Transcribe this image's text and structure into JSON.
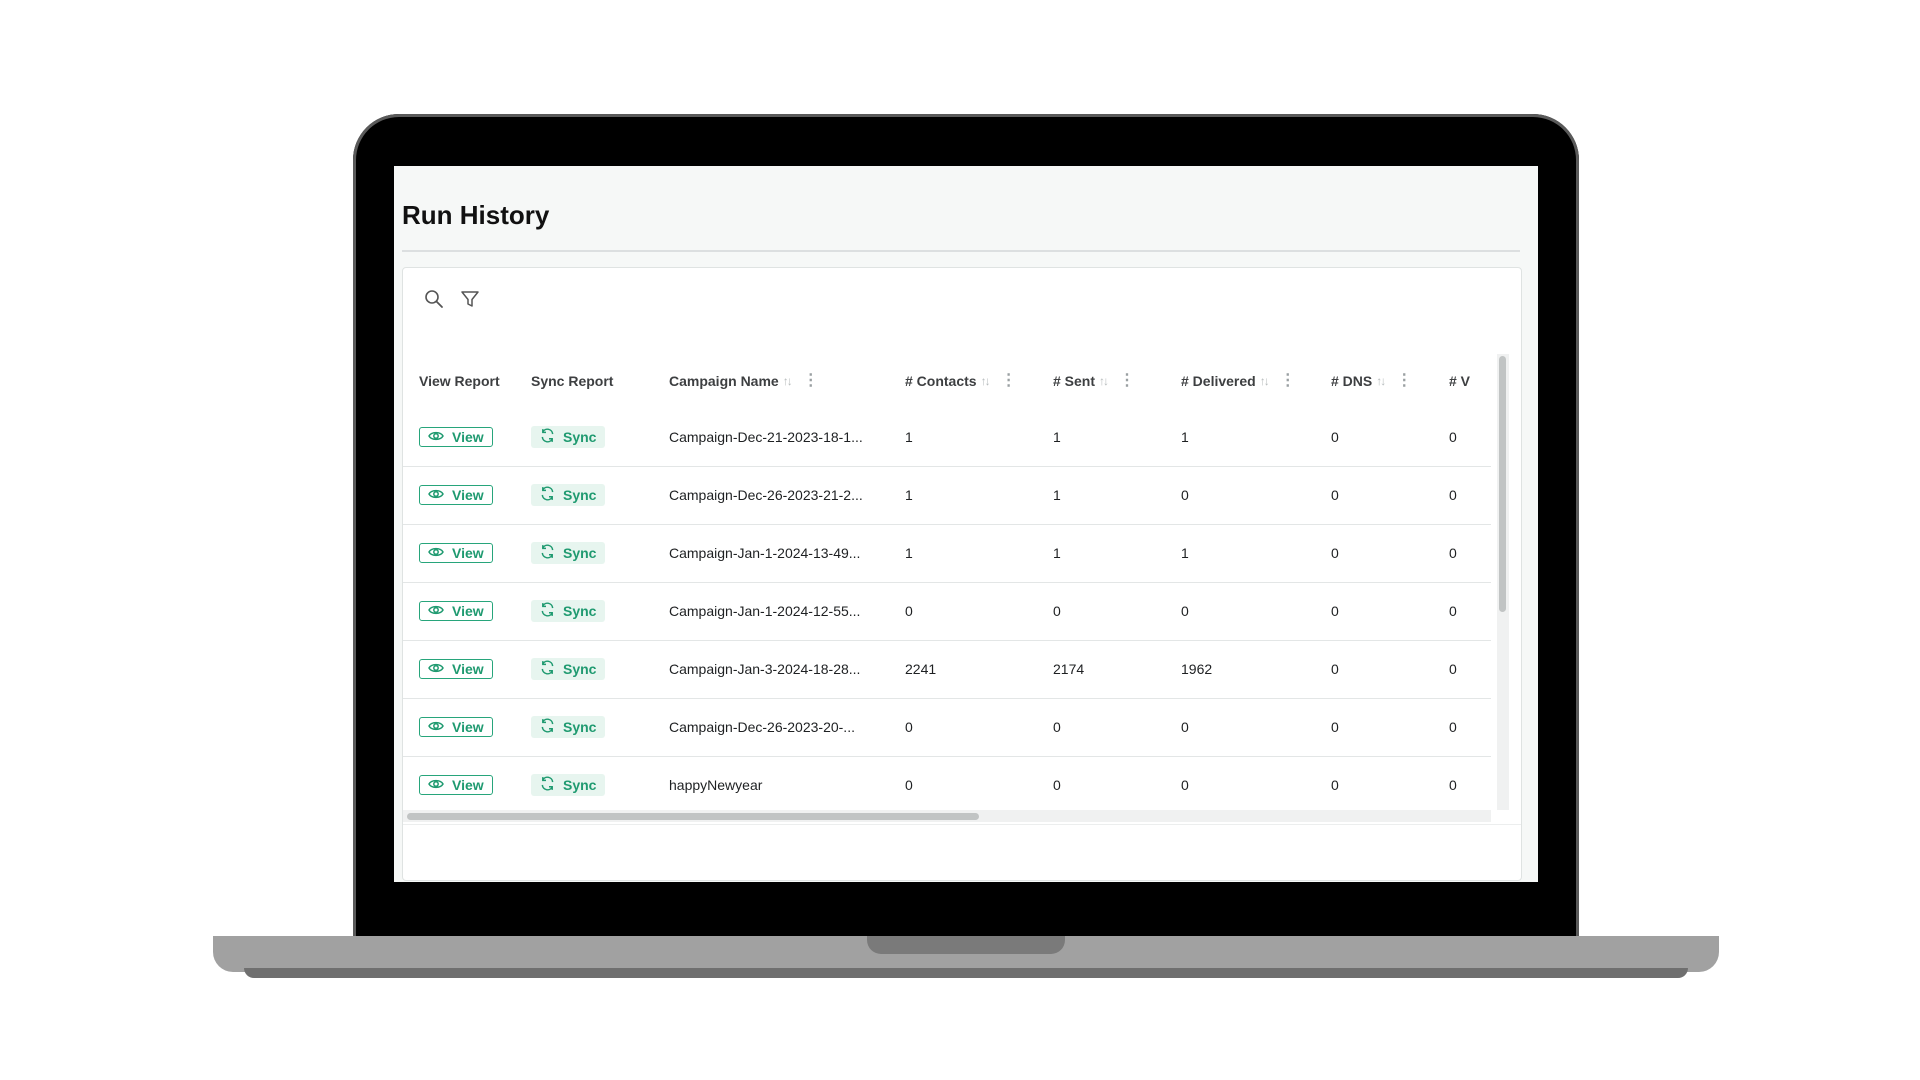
{
  "page": {
    "title": "Run History"
  },
  "toolbar": {
    "search_icon": "search-icon",
    "filter_icon": "filter-icon"
  },
  "table": {
    "columns": {
      "view_report": "View Report",
      "sync_report": "Sync Report",
      "campaign_name": "Campaign Name",
      "contacts": "# Contacts",
      "sent": "# Sent",
      "delivered": "# Delivered",
      "dns": "# DNS",
      "next": "# V"
    },
    "rows": [
      {
        "view": "View",
        "sync": "Sync",
        "campaign": "Campaign-Dec-21-2023-18-1...",
        "contacts": "1",
        "sent": "1",
        "delivered": "1",
        "dns": "0",
        "next": "0"
      },
      {
        "view": "View",
        "sync": "Sync",
        "campaign": "Campaign-Dec-26-2023-21-2...",
        "contacts": "1",
        "sent": "1",
        "delivered": "0",
        "dns": "0",
        "next": "0"
      },
      {
        "view": "View",
        "sync": "Sync",
        "campaign": "Campaign-Jan-1-2024-13-49...",
        "contacts": "1",
        "sent": "1",
        "delivered": "1",
        "dns": "0",
        "next": "0"
      },
      {
        "view": "View",
        "sync": "Sync",
        "campaign": "Campaign-Jan-1-2024-12-55...",
        "contacts": "0",
        "sent": "0",
        "delivered": "0",
        "dns": "0",
        "next": "0"
      },
      {
        "view": "View",
        "sync": "Sync",
        "campaign": "Campaign-Jan-3-2024-18-28...",
        "contacts": "2241",
        "sent": "2174",
        "delivered": "1962",
        "dns": "0",
        "next": "0"
      },
      {
        "view": "View",
        "sync": "Sync",
        "campaign": "Campaign-Dec-26-2023-20-...",
        "contacts": "0",
        "sent": "0",
        "delivered": "0",
        "dns": "0",
        "next": "0"
      },
      {
        "view": "View",
        "sync": "Sync",
        "campaign": "happyNewyear",
        "contacts": "0",
        "sent": "0",
        "delivered": "0",
        "dns": "0",
        "next": "0"
      }
    ]
  },
  "colors": {
    "accent": "#1f9a70",
    "sync_bg": "#e7f5ef"
  }
}
